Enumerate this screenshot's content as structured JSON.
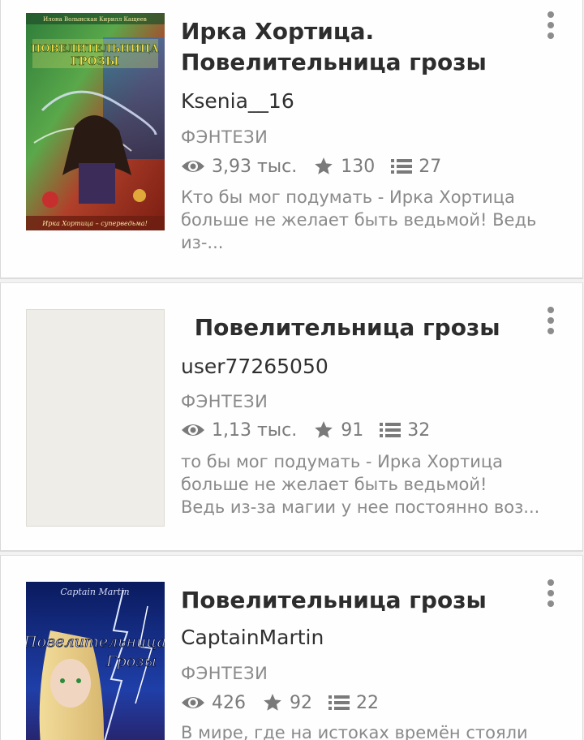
{
  "books": [
    {
      "title_line1": "Ирка Хортица.",
      "title_line2": "Повелительница грозы",
      "author": "Ksenia__16",
      "genre": "ФЭНТЕЗИ",
      "views": "3,93 тыс.",
      "stars": "130",
      "chapters": "27",
      "desc_lines": [
        "Кто бы мог подумать - Ирка Хортица",
        "больше не желает быть ведьмой! Ведь",
        "из-..."
      ],
      "cover_top_text": "Илона Волынская  Кирилл Кащеев",
      "cover_title": "ПОВЕЛИТЕЛЬНИЦА ГРОЗЫ",
      "cover_bottom_text": "Ирка Хортица – суперведьма!"
    },
    {
      "title_line1": " Повелительница грозы",
      "author": "user77265050",
      "genre": "ФЭНТЕЗИ",
      "views": "1,13 тыс.",
      "stars": "91",
      "chapters": "32",
      "desc_lines": [
        "то бы мог подумать - Ирка Хортица",
        "больше не желает быть ведьмой!",
        "Ведь из-за магии у нее постоянно воз..."
      ]
    },
    {
      "title_line1": "Повелительница грозы",
      "author": "CaptainMartin",
      "genre": "ФЭНТЕЗИ",
      "views": "426",
      "stars": "92",
      "chapters": "22",
      "desc_lines": [
        "В мире, где на истоках времён стояли"
      ],
      "cover_top_text": "Captain Martin",
      "cover_title_1": "Повелительница",
      "cover_title_2": "Грозы"
    }
  ],
  "icons": {
    "views": "eye-icon",
    "stars": "star-icon",
    "chapters": "list-icon",
    "menu": "more-vert-icon"
  },
  "colors": {
    "text_primary": "#2d2d2d",
    "text_secondary": "#8a8a8a",
    "icon": "#7a7a7a",
    "card_bg": "#fefefe"
  }
}
